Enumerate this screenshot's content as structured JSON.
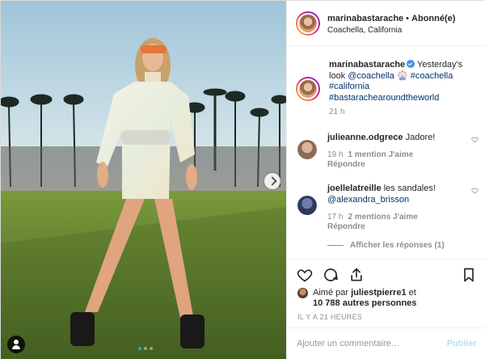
{
  "post": {
    "author": "marinabastarache",
    "follow_status": "Abonné(e)",
    "separator": "•",
    "location": "Coachella, California"
  },
  "caption": {
    "username": "marinabastarache",
    "text_1": "Yesterday's look",
    "mention": "@coachella",
    "emoji": "🎡",
    "tag_1": "#coachella",
    "tag_2": "#california",
    "tag_3": "#bastarachearoundtheworld",
    "time": "21 h"
  },
  "comments": [
    {
      "username": "julieanne.odgrece",
      "text": "Jadore!",
      "time": "19 h",
      "likes": "1 mention J'aime",
      "reply": "Répondre"
    },
    {
      "username": "joellelatreille",
      "text": "les sandales!",
      "mention": "@alexandra_brisson",
      "time": "17 h",
      "likes": "2 mentions J'aime",
      "reply": "Répondre"
    }
  ],
  "view_replies": "Afficher les réponses (1)",
  "icons": {
    "like": "heart-icon",
    "comment": "comment-icon",
    "share": "share-icon",
    "save": "bookmark-icon",
    "comment_like": "heart-icon",
    "tag_user": "user-icon",
    "next": "chevron-right-icon"
  },
  "likes": {
    "prefix": "Aimé par",
    "user": "juliestpierre1",
    "conj": "et",
    "count": "10 788 autres personnes"
  },
  "posted_ago": "IL Y A 21 HEURES",
  "add_comment": {
    "placeholder": "Ajouter un commentaire…",
    "publish": "Publier"
  },
  "carousel": {
    "count": 3,
    "active": 1
  },
  "colors": {
    "link": "#003569",
    "verified": "#3897f0",
    "muted": "#8e8e8e",
    "publish_disabled": "#b2dffc"
  }
}
